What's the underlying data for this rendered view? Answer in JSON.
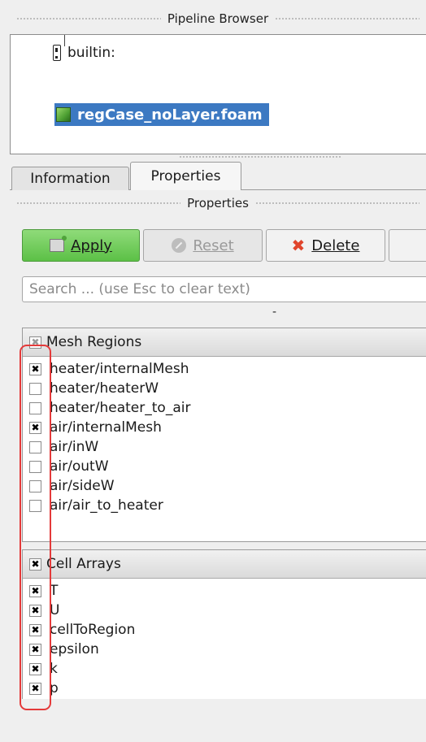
{
  "pipeline_browser": {
    "title": "Pipeline Browser",
    "items": [
      {
        "label": "builtin:"
      },
      {
        "label": "regCase_noLayer.foam"
      }
    ]
  },
  "tabs": [
    {
      "label": "Information"
    },
    {
      "label": "Properties"
    }
  ],
  "properties": {
    "title": "Properties",
    "buttons": {
      "apply": "Apply",
      "reset": "Reset",
      "delete": "Delete"
    },
    "search_placeholder": "Search ... (use Esc to clear text)",
    "divider_dash": "-"
  },
  "mesh_regions": {
    "header": "Mesh Regions",
    "items": [
      {
        "label": "heater/internalMesh",
        "checked": true
      },
      {
        "label": "heater/heaterW",
        "checked": false
      },
      {
        "label": "heater/heater_to_air",
        "checked": false
      },
      {
        "label": "air/internalMesh",
        "checked": true
      },
      {
        "label": "air/inW",
        "checked": false
      },
      {
        "label": "air/outW",
        "checked": false
      },
      {
        "label": "air/sideW",
        "checked": false
      },
      {
        "label": "air/air_to_heater",
        "checked": false
      }
    ]
  },
  "cell_arrays": {
    "header": "Cell Arrays",
    "items": [
      {
        "label": "T",
        "checked": true
      },
      {
        "label": "U",
        "checked": true
      },
      {
        "label": "cellToRegion",
        "checked": true
      },
      {
        "label": "epsilon",
        "checked": true
      },
      {
        "label": "k",
        "checked": true
      },
      {
        "label": "p",
        "checked": true
      }
    ]
  },
  "colors": {
    "selection": "#3c79c2",
    "apply_green": "#5cc046",
    "highlight_red": "#e43a3a"
  }
}
